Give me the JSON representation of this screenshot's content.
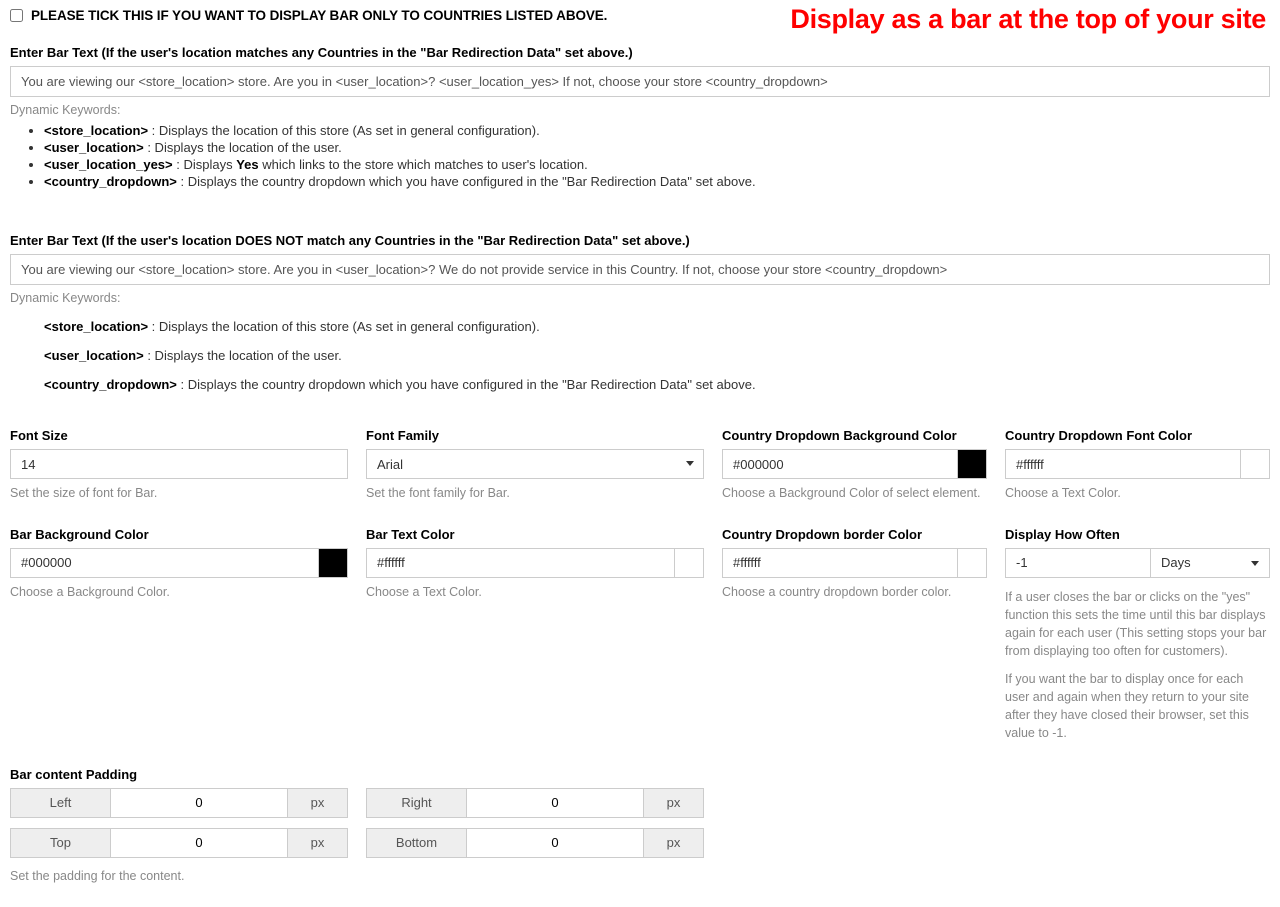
{
  "banner": "Display as a bar at the top of your site",
  "checkbox": {
    "label": "PLEASE TICK THIS IF YOU WANT TO DISPLAY BAR ONLY TO COUNTRIES LISTED ABOVE."
  },
  "bar1": {
    "label": "Enter Bar Text (If the user's location matches any Countries in the \"Bar Redirection Data\" set above.)",
    "value": "You are viewing our <store_location> store. Are you in <user_location>? <user_location_yes> If not, choose your store <country_dropdown>",
    "dyn_label": "Dynamic Keywords:",
    "kw": {
      "store_location_k": "<store_location>",
      "store_location_d": " : Displays the location of this store (As set in general configuration).",
      "user_location_k": "<user_location>",
      "user_location_d": " : Displays the location of the user.",
      "user_location_yes_k": "<user_location_yes>",
      "user_location_yes_d1": " : Displays ",
      "user_location_yes_yes": "Yes",
      "user_location_yes_d2": " which links to the store which matches to user's location.",
      "country_dropdown_k": "<country_dropdown>",
      "country_dropdown_d": " : Displays the country dropdown which you have configured in the \"Bar Redirection Data\" set above."
    }
  },
  "bar2": {
    "label": "Enter Bar Text (If the user's location DOES NOT match any Countries in the \"Bar Redirection Data\" set above.)",
    "value": "You are viewing our <store_location> store. Are you in <user_location>? We do not provide service in this Country. If not, choose your store <country_dropdown>",
    "dyn_label": "Dynamic Keywords:",
    "kw": {
      "store_location_k": "<store_location>",
      "store_location_d": " : Displays the location of this store (As set in general configuration).",
      "user_location_k": "<user_location>",
      "user_location_d": " : Displays the location of the user.",
      "country_dropdown_k": "<country_dropdown>",
      "country_dropdown_d": " : Displays the country dropdown which you have configured in the \"Bar Redirection Data\" set above."
    }
  },
  "grid": {
    "font_size": {
      "label": "Font Size",
      "value": "14",
      "help": "Set the size of font for Bar."
    },
    "font_family": {
      "label": "Font Family",
      "value": "Arial",
      "help": "Set the font family for Bar."
    },
    "dd_bg": {
      "label": "Country Dropdown Background Color",
      "value": "#000000",
      "swatch": "#000000",
      "help": "Choose a Background Color of select element."
    },
    "dd_font": {
      "label": "Country Dropdown Font Color",
      "value": "#ffffff",
      "swatch": "#ffffff",
      "help": "Choose a Text Color."
    },
    "bar_bg": {
      "label": "Bar Background Color",
      "value": "#000000",
      "swatch": "#000000",
      "help": "Choose a Background Color."
    },
    "bar_text": {
      "label": "Bar Text Color",
      "value": "#ffffff",
      "swatch": "#ffffff",
      "help": "Choose a Text Color."
    },
    "dd_border": {
      "label": "Country Dropdown border Color",
      "value": "#ffffff",
      "swatch": "#ffffff",
      "help": "Choose a country dropdown border color."
    },
    "often": {
      "label": "Display How Often",
      "value": "-1",
      "unit": "Days",
      "p1": "If a user closes the bar or clicks on the \"yes\" function this sets the time until this bar displays again for each user (This setting stops your bar from displaying too often for customers).",
      "p2": "If you want the bar to display once for each user and again when they return to your site after they have closed their browser, set this value to -1."
    },
    "padding": {
      "label": "Bar content Padding",
      "left_l": "Left",
      "left_v": "0",
      "right_l": "Right",
      "right_v": "0",
      "top_l": "Top",
      "top_v": "0",
      "bottom_l": "Bottom",
      "bottom_v": "0",
      "unit": "px",
      "help": "Set the padding for the content."
    }
  }
}
